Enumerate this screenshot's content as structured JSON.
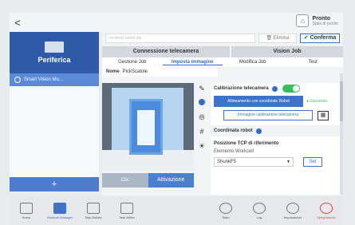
{
  "topbar": {
    "back_label": "<",
    "status_title": "Pronto",
    "status_sub": "Stato di pronto"
  },
  "left": {
    "panel_title": "Periferica",
    "item": "Smart Vision Mo...",
    "add_label": "+"
  },
  "main": {
    "search_placeholder": "Inserisci nome job",
    "elimina_label": "Elimina",
    "conferma_label": "Conferma",
    "sections": [
      "Connessione telecamera",
      "Vision Job"
    ],
    "steps": [
      "Gestione Job",
      "Imposta immagine",
      "Modifica Job",
      "Test"
    ],
    "name_label": "Nome",
    "name_value": "PickScatole",
    "cam_btn_left": "Clic",
    "cam_btn_right": "Attivazione"
  },
  "right": {
    "calib_label": "Calibrazione telecamera",
    "btn_robot": "Allineamento con coordinate Robot",
    "success": "Successo",
    "btn_img": "Immagine calibrazione telecamera",
    "coord_label": "Coordinata robot",
    "pos_label": "Posizione TCP di riferimento",
    "elem_label": "Elemento Workcell",
    "select_value": "ShunkF5",
    "set_label": "Set"
  },
  "nav": {
    "left": [
      "Home",
      "Workcell Manager",
      "Task Builder",
      "Task Writer"
    ],
    "right": [
      "Stato",
      "Log",
      "Impostazioni",
      "Spegnimento"
    ]
  },
  "icons": [
    "home-icon",
    "workcell-icon",
    "builder-icon",
    "writer-icon",
    "status-icon",
    "log-icon",
    "settings-icon",
    "power-icon"
  ],
  "colors": {
    "accent": "#2f6ccc",
    "success": "#3bbd5c",
    "stop": "#e04848"
  }
}
